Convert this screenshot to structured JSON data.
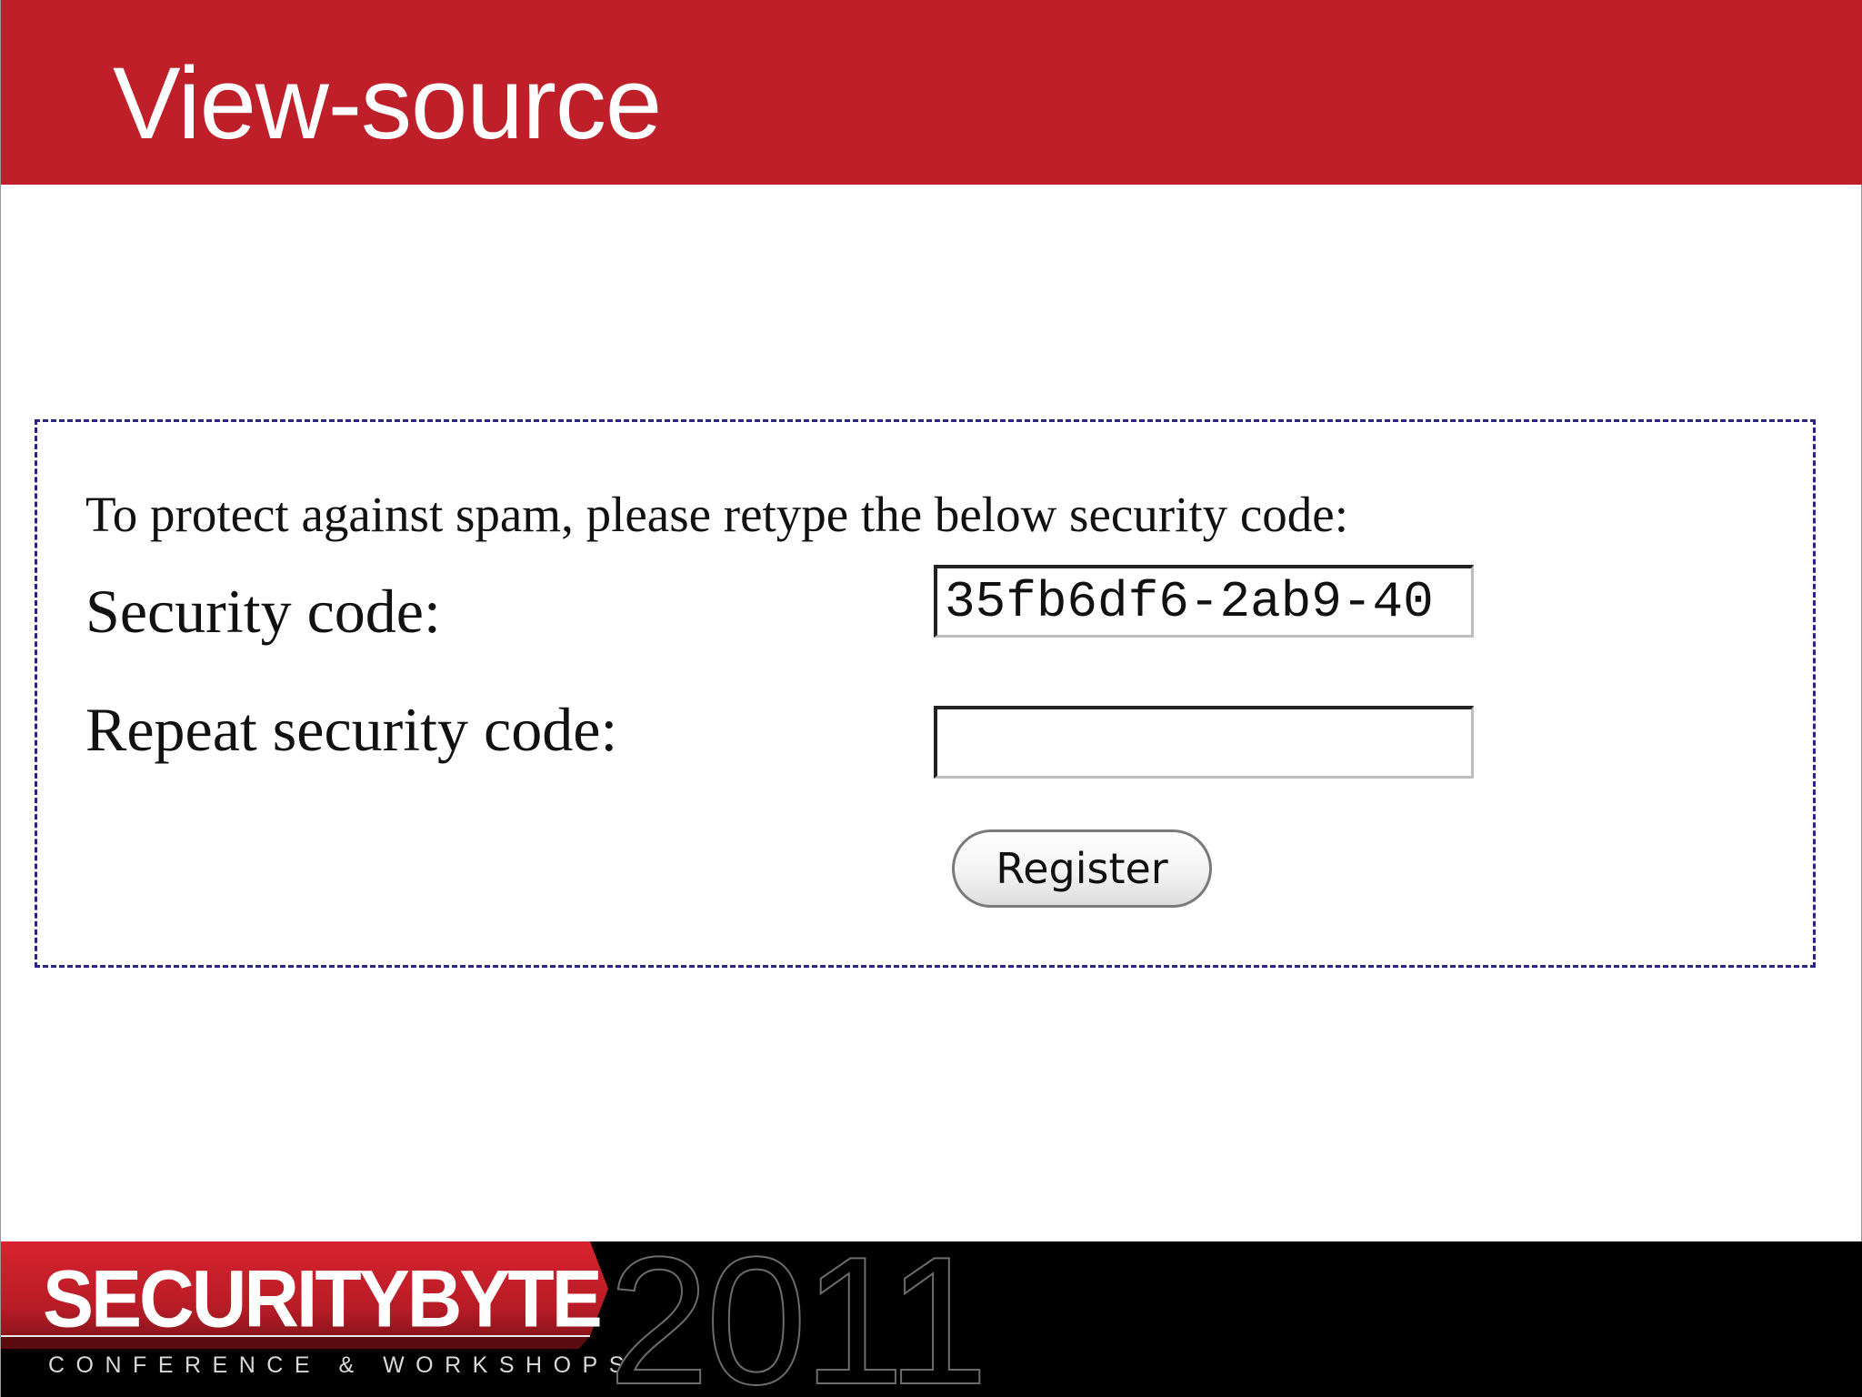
{
  "slide": {
    "title": "View-source"
  },
  "form": {
    "instructions": "To protect against spam, please retype the below security code:",
    "security_code_label": "Security code:",
    "security_code_value": "35fb6df6-2ab9-40",
    "repeat_label": "Repeat security code:",
    "repeat_value": "",
    "register_label": "Register"
  },
  "footer": {
    "brand": "SECURITYBYTE",
    "tagline": "CONFERENCE & WORKSHOPS",
    "year": "2011"
  },
  "colors": {
    "title_bar": "#be1f29",
    "dashed_border": "#2a2580",
    "footer_bg": "#000000"
  }
}
